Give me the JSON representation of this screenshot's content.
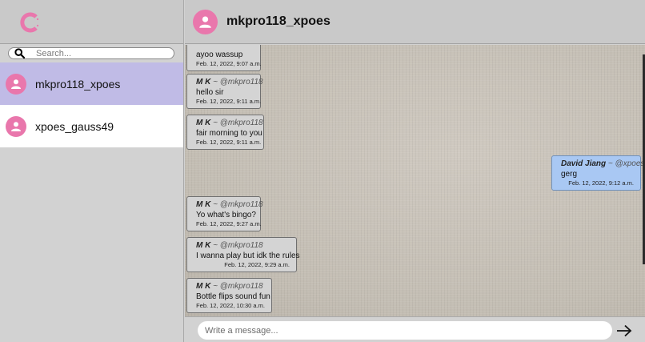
{
  "search": {
    "placeholder": "Search..."
  },
  "contacts": [
    {
      "name": "mkpro118_xpoes",
      "active": true
    },
    {
      "name": "xpoes_gauss49",
      "active": false
    }
  ],
  "chat": {
    "title": "mkpro118_xpoes"
  },
  "composer": {
    "placeholder": "Write a message..."
  },
  "messages": [
    {
      "sender": "",
      "handle": "",
      "text": "ayoo wassup",
      "time": "Feb. 12, 2022, 9:07 a.m."
    },
    {
      "sender": "M K",
      "handle": "~ @mkpro118",
      "text": "hello sir",
      "time": "Feb. 12, 2022, 9:11 a.m."
    },
    {
      "sender": "M K",
      "handle": "~ @mkpro118",
      "text": "fair morning to you",
      "time": "Feb. 12, 2022, 9:11 a.m."
    },
    {
      "sender": "David Jiang",
      "handle": "~ @xpoes",
      "text": "gerg",
      "time": "Feb. 12, 2022, 9:12 a.m."
    },
    {
      "sender": "M K",
      "handle": "~ @mkpro118",
      "text": "Yo what's bingo?",
      "time": "Feb. 12, 2022, 9:27 a.m."
    },
    {
      "sender": "M K",
      "handle": "~ @mkpro118",
      "text": "I wanna play but idk the rules",
      "time": "Feb. 12, 2022, 9:29 a.m."
    },
    {
      "sender": "M K",
      "handle": "~ @mkpro118",
      "text": "Bottle flips sound fun",
      "time": "Feb. 12, 2022, 10:30 a.m."
    }
  ],
  "colors": {
    "accent": "#e977ac",
    "active_contact": "#c0bbe6",
    "outgoing_bubble": "#a9c8f3"
  },
  "icons": {
    "logo": "c-logo-icon",
    "search": "search-icon",
    "avatar": "user-icon",
    "send": "arrow-right-icon"
  }
}
